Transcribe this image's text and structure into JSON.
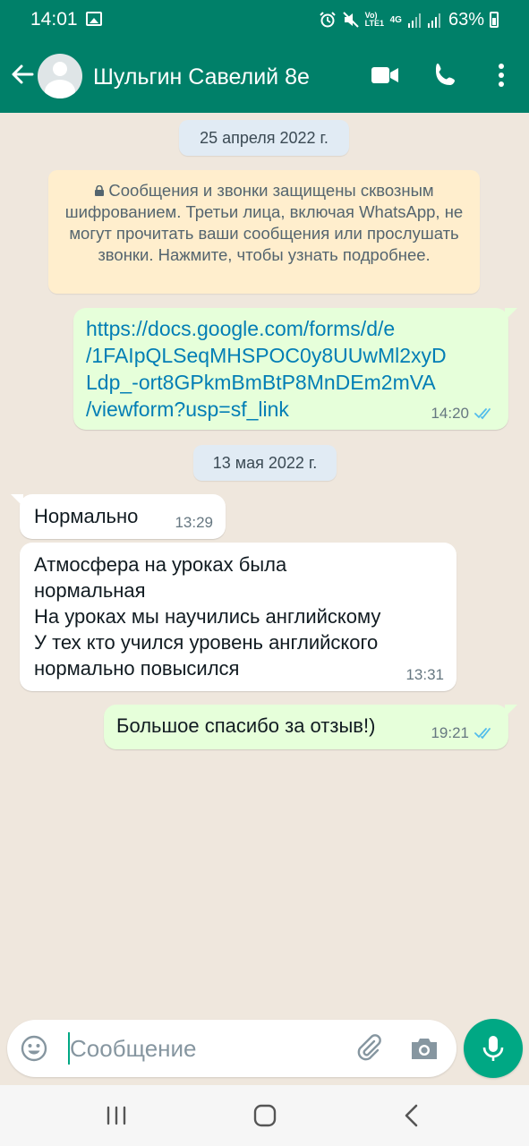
{
  "status_bar": {
    "time": "14:01",
    "network_label": "Vo) LTE1",
    "network_type": "4G",
    "battery": "63%"
  },
  "header": {
    "contact_name": "Шульгин Савелий 8е",
    "icons": [
      "back-arrow-icon",
      "avatar",
      "video-call-icon",
      "phone-icon",
      "more-vert-icon"
    ],
    "bg_color": "#008069"
  },
  "chat": {
    "dates": {
      "first": "25 апреля 2022 г.",
      "second": "13 мая 2022 г."
    },
    "encryption_notice": "Сообщения и звонки защищены сквозным шифрованием. Третьи лица, включая WhatsApp, не могут прочитать ваши сообщения или прослушать звонки. Нажмите, чтобы узнать подробнее.",
    "messages": [
      {
        "direction": "out",
        "lines": [
          "https://docs.google.com/forms/d/e",
          "/1FAIpQLSeqMHSPOC0y8UUwMl2xyD",
          "Ldp_-ort8GPkmBmBtP8MnDEm2mVA",
          "/viewform?usp=sf_link"
        ],
        "time": "14:20",
        "status": "read"
      },
      {
        "direction": "in",
        "text": "Нормально",
        "time": "13:29"
      },
      {
        "direction": "in",
        "lines": [
          "Атмосфера на уроках была",
          "нормальная",
          "На уроках мы научились английскому",
          "У тех кто учился уровень английского",
          "нормально повысился"
        ],
        "time": "13:31"
      },
      {
        "direction": "out",
        "text": "Большое спасибо за отзыв!)",
        "time": "19:21",
        "status": "read"
      }
    ],
    "colors": {
      "outgoing_bubble": "#e6ffda",
      "incoming_bubble": "#ffffff",
      "read_ticks": "#53bdeb",
      "link": "#027eb5"
    }
  },
  "composer": {
    "placeholder": "Сообщение",
    "icons": [
      "emoji-icon",
      "attach-icon",
      "camera-icon",
      "mic-icon"
    ],
    "accent": "#00a884"
  },
  "nav_bar": {
    "icons": [
      "recent-apps-icon",
      "home-icon",
      "back-icon"
    ]
  }
}
